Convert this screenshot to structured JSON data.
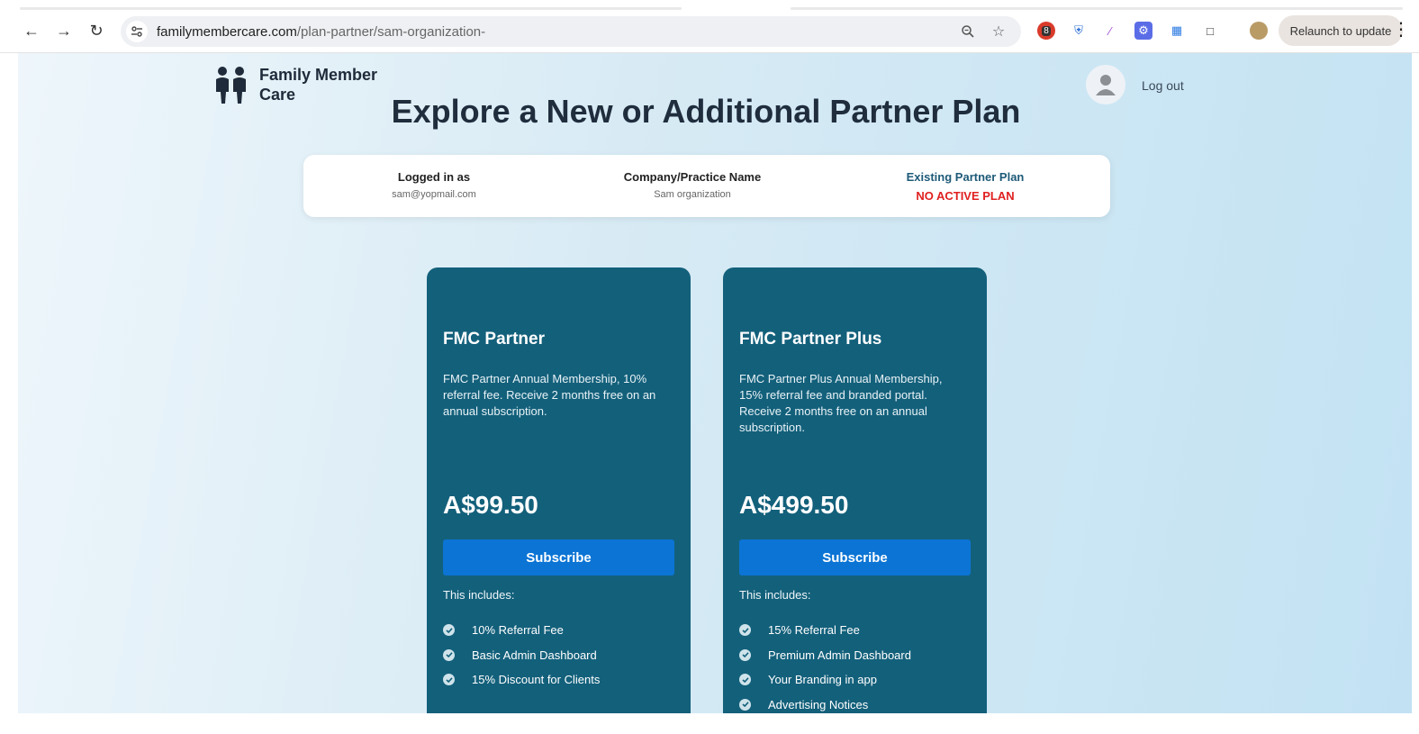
{
  "browser": {
    "url_domain": "familymembercare.com",
    "url_path": "/plan-partner/sam-organization-",
    "relaunch_label": "Relaunch to update",
    "ext_badge": "8"
  },
  "header": {
    "brand_line1": "Family Member",
    "brand_line2": "Care",
    "logout_label": "Log out"
  },
  "page": {
    "title": "Explore a New or Additional Partner Plan"
  },
  "account": {
    "logged_in_label": "Logged in as",
    "logged_in_value": "sam@yopmail.com",
    "company_label": "Company/Practice Name",
    "company_value": "Sam organization",
    "plan_label": "Existing Partner Plan",
    "plan_value": "NO ACTIVE PLAN"
  },
  "plans": [
    {
      "name": "FMC Partner",
      "description": "FMC Partner Annual Membership, 10% referral fee. Receive 2 months free on an annual subscription.",
      "price": "A$99.50",
      "subscribe_label": "Subscribe",
      "includes_label": "This includes:",
      "features": [
        "10% Referral Fee",
        "Basic Admin Dashboard",
        "15% Discount for Clients"
      ]
    },
    {
      "name": "FMC Partner Plus",
      "description": "FMC Partner Plus Annual Membership, 15% referral fee and branded portal. Receive 2 months free on an annual subscription.",
      "price": "A$499.50",
      "subscribe_label": "Subscribe",
      "includes_label": "This includes:",
      "features": [
        "15% Referral Fee",
        "Premium Admin Dashboard",
        "Your Branding in app",
        "Advertising Notices"
      ]
    }
  ],
  "colors": {
    "card": "#13607b",
    "button": "#0b74d4",
    "alert": "#e02020",
    "title": "#1f2d3d"
  }
}
